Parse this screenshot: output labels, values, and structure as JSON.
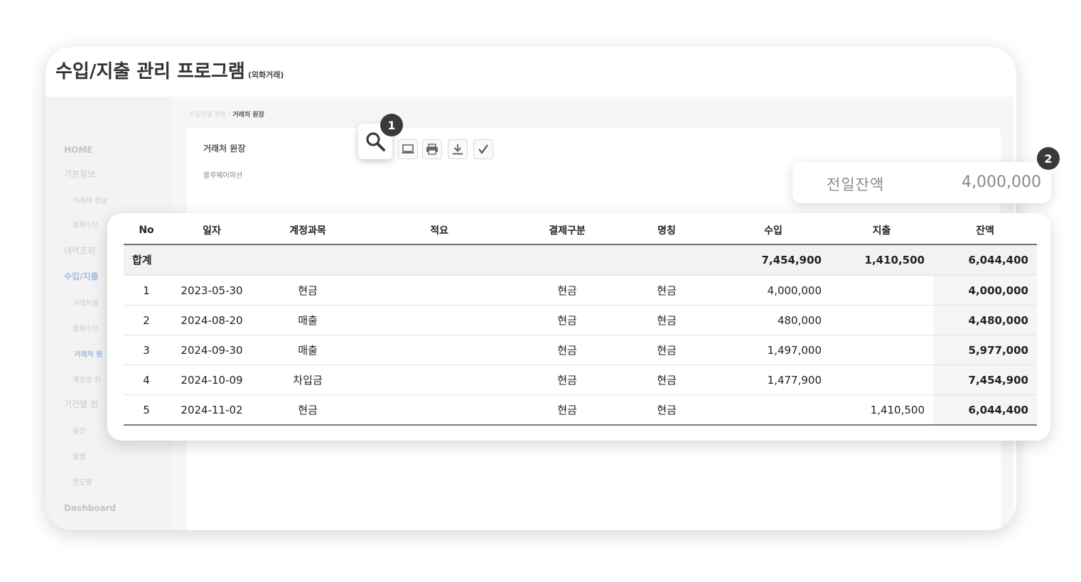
{
  "app": {
    "title": "수입/지출 관리 프로그램",
    "subtitle": "(외화거래)"
  },
  "breadcrumb": {
    "parent": "수입지출 현황 /",
    "current": "거래처 원장"
  },
  "sidebar": {
    "items": [
      {
        "label": "HOME"
      },
      {
        "label": "기본정보"
      },
      {
        "label": "거래처 정보"
      },
      {
        "label": "결제수단"
      },
      {
        "label": "내역조회"
      },
      {
        "label": "수입/지출"
      },
      {
        "label": "거래처별"
      },
      {
        "label": "결제수단"
      },
      {
        "label": "거래처 원"
      },
      {
        "label": "계정별 현"
      },
      {
        "label": "기간별 현"
      },
      {
        "label": "월간"
      },
      {
        "label": "월별"
      },
      {
        "label": "연도별"
      },
      {
        "label": "Dashboard"
      }
    ]
  },
  "content": {
    "title": "거래처 원장",
    "client": "블루웨어파션"
  },
  "toolbar": {
    "icons": [
      "search-icon",
      "monitor-icon",
      "print-icon",
      "download-icon",
      "check-icon"
    ]
  },
  "callouts": {
    "one": "1",
    "two": "2"
  },
  "balance": {
    "label": "전일잔액",
    "value": "4,000,000"
  },
  "table": {
    "columns": [
      "No",
      "일자",
      "계정과목",
      "적요",
      "결제구분",
      "명칭",
      "수입",
      "지출",
      "잔액"
    ],
    "total": {
      "label": "합계",
      "income": "7,454,900",
      "expense": "1,410,500",
      "balance": "6,044,400"
    },
    "rows": [
      {
        "no": "1",
        "date": "2023-05-30",
        "account": "현금",
        "memo": "",
        "payment": "현금",
        "name": "현금",
        "income": "4,000,000",
        "expense": "",
        "balance": "4,000,000"
      },
      {
        "no": "2",
        "date": "2024-08-20",
        "account": "매출",
        "memo": "",
        "payment": "현금",
        "name": "현금",
        "income": "480,000",
        "expense": "",
        "balance": "4,480,000"
      },
      {
        "no": "3",
        "date": "2024-09-30",
        "account": "매출",
        "memo": "",
        "payment": "현금",
        "name": "현금",
        "income": "1,497,000",
        "expense": "",
        "balance": "5,977,000"
      },
      {
        "no": "4",
        "date": "2024-10-09",
        "account": "차입금",
        "memo": "",
        "payment": "현금",
        "name": "현금",
        "income": "1,477,900",
        "expense": "",
        "balance": "7,454,900"
      },
      {
        "no": "5",
        "date": "2024-11-02",
        "account": "현금",
        "memo": "",
        "payment": "현금",
        "name": "현금",
        "income": "",
        "expense": "1,410,500",
        "balance": "6,044,400"
      }
    ]
  },
  "colors": {
    "income": "#3cc9a0",
    "expense": "#f2bd2c",
    "sidebar_active": "#9bbde2"
  }
}
